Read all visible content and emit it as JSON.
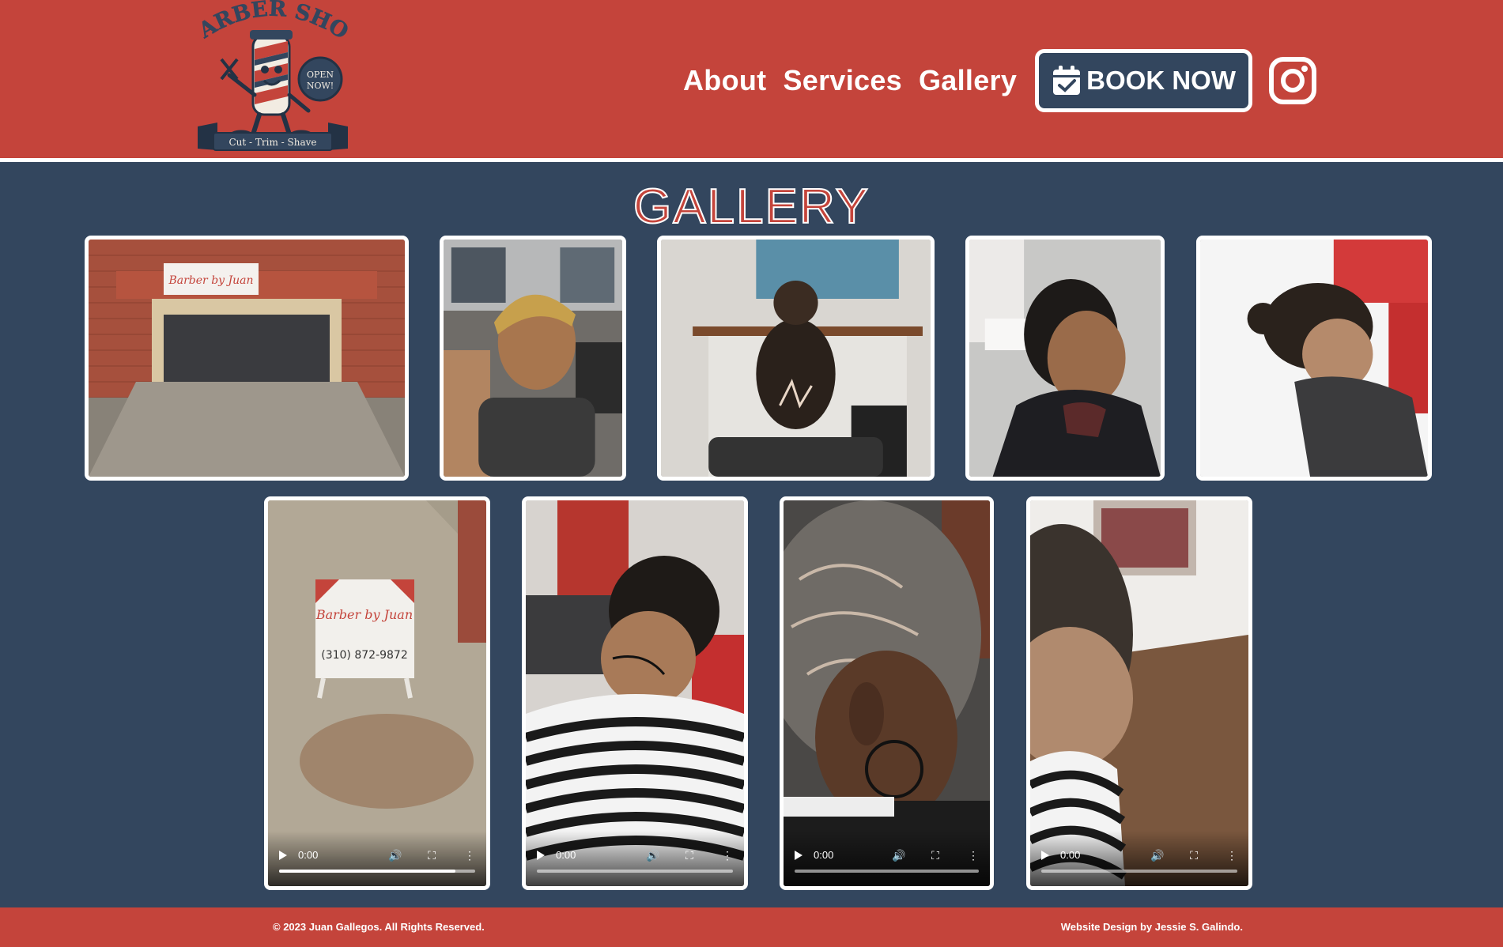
{
  "brand": {
    "logo_text_top": "BARBER SHOP",
    "logo_badge": "OPEN NOW!",
    "logo_ribbon": "Cut - Trim - Shave"
  },
  "nav": {
    "about": "About",
    "services": "Services",
    "gallery": "Gallery",
    "book": "BOOK NOW",
    "instagram_icon": "instagram-icon",
    "calendar_icon": "calendar-check-icon"
  },
  "gallery": {
    "title": "GALLERY",
    "photos": [
      {
        "alt": "Barber by Juan storefront",
        "sign": "Barber by Juan"
      },
      {
        "alt": "Boy with blond fade haircut"
      },
      {
        "alt": "Bun with nape design"
      },
      {
        "alt": "Short fade haircut"
      },
      {
        "alt": "Man bun with undercut fade"
      }
    ],
    "videos": [
      {
        "time": "0:00",
        "sign": "Barber by Juan",
        "phone": "(310) 872-9872",
        "progress": 0.9
      },
      {
        "time": "0:00",
        "progress": 0
      },
      {
        "time": "0:00",
        "progress": 0
      },
      {
        "time": "0:00",
        "progress": 0
      }
    ]
  },
  "footer": {
    "copyright": "© 2023 Juan Gallegos. All Rights Reserved.",
    "credit": "Website Design by Jessie S. Galindo."
  },
  "colors": {
    "brand_red": "#c4443b",
    "navy": "#33465e",
    "white": "#ffffff"
  }
}
